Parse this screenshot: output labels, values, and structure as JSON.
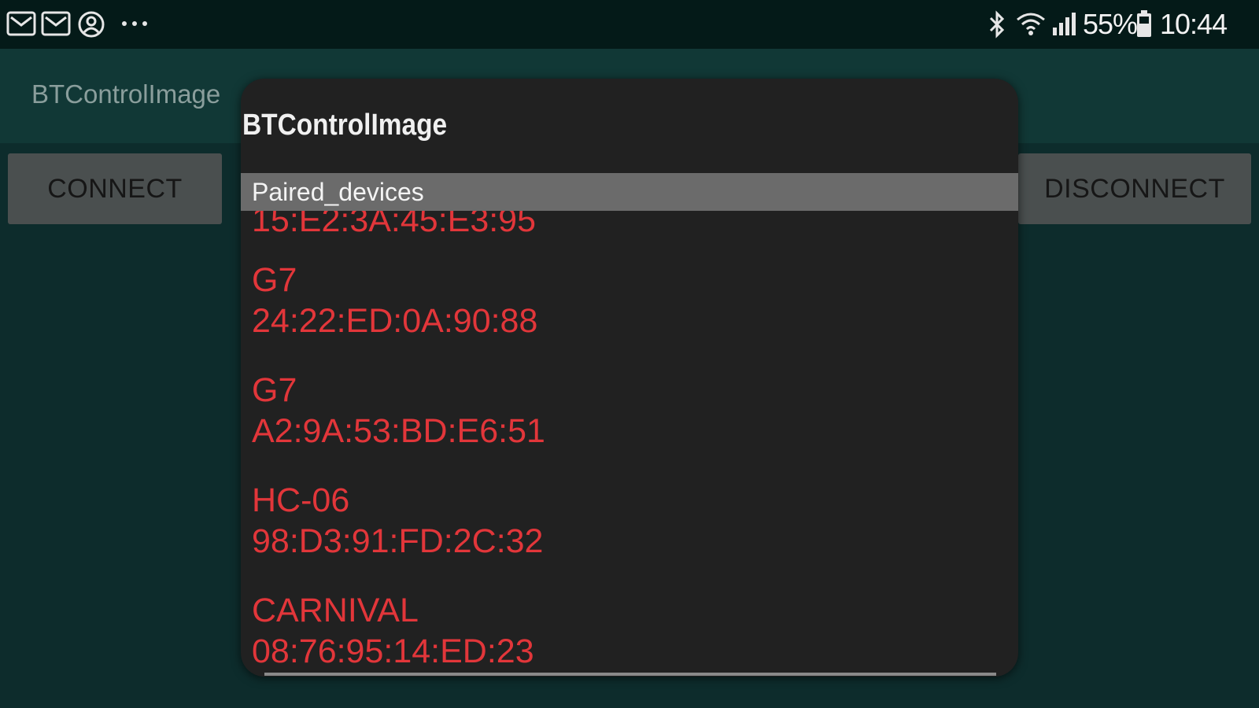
{
  "status_bar": {
    "battery": "55%",
    "time": "10:44",
    "icons": [
      "mail-icon",
      "mail-icon",
      "account-icon",
      "more-dots-icon",
      "bluetooth-icon",
      "wifi-icon",
      "signal-icon",
      "battery-icon"
    ]
  },
  "app": {
    "title": "BTControlImage"
  },
  "buttons": {
    "connect": "CONNECT",
    "disconnect": "DISCONNECT"
  },
  "dialog": {
    "title": "BTControlImage",
    "list_header": "Paired_devices",
    "devices": [
      {
        "name": "",
        "address": "15:E2:3A:45:E3:95"
      },
      {
        "name": "G7",
        "address": "24:22:ED:0A:90:88"
      },
      {
        "name": "G7",
        "address": "A2:9A:53:BD:E6:51"
      },
      {
        "name": "HC-06",
        "address": "98:D3:91:FD:2C:32"
      },
      {
        "name": "CARNIVAL",
        "address": "08:76:95:14:ED:23"
      }
    ]
  },
  "colors": {
    "background": "#0d2c2c",
    "dialog": "#212121",
    "device_text": "#e2363a",
    "header_bar": "#6b6b6b"
  }
}
